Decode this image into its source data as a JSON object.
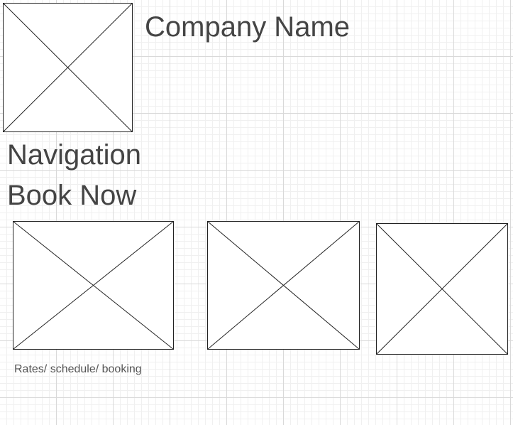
{
  "header": {
    "company_name": "Company Name",
    "logo_icon": "image-placeholder-icon"
  },
  "navigation": {
    "label": "Navigation",
    "book_now": "Book Now"
  },
  "gallery": {
    "caption": "Rates/ schedule/ booking",
    "image_icon": "image-placeholder-icon"
  }
}
